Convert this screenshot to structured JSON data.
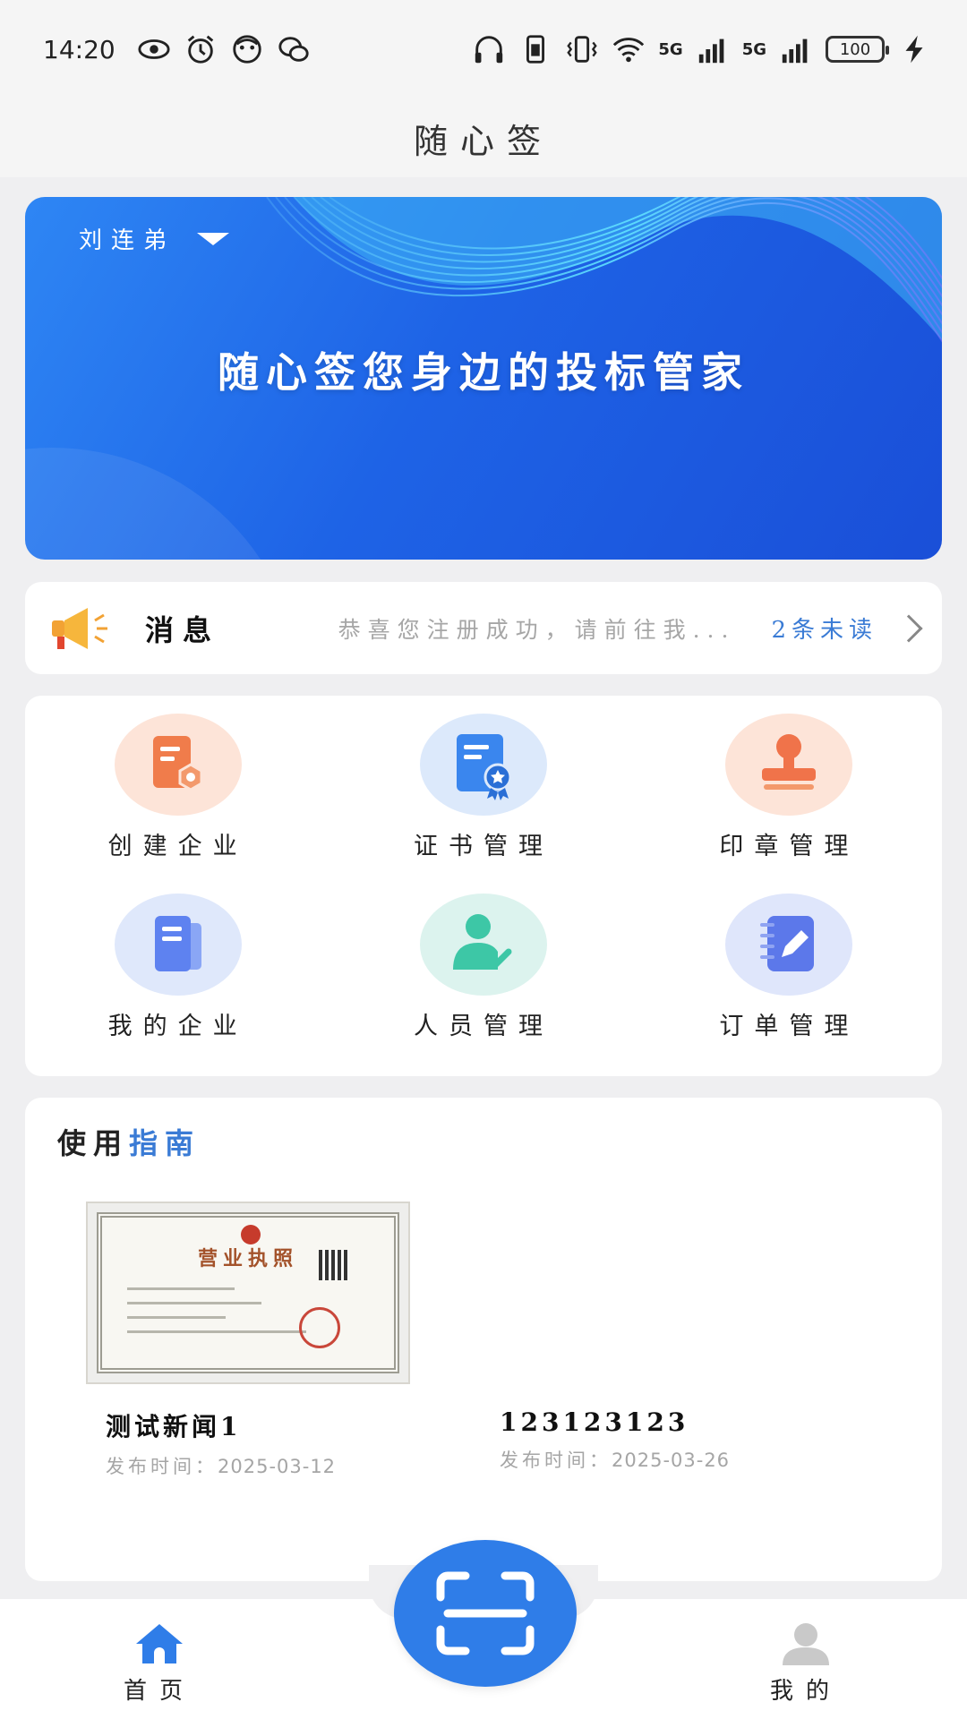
{
  "status_bar": {
    "time": "14:20",
    "signal1": "5G",
    "signal2": "5G",
    "battery": "100"
  },
  "header": {
    "title": "随心签"
  },
  "banner": {
    "user_name": "刘连弟",
    "slogan": "随心签您身边的投标管家"
  },
  "messages": {
    "title": "消息",
    "preview": "恭喜您注册成功，请前往我...",
    "unread": "2条未读"
  },
  "grid": {
    "items": [
      {
        "label": "创建企业",
        "icon": "company-create-icon",
        "bg": "#fde4d8",
        "color": "#f07c4b"
      },
      {
        "label": "证书管理",
        "icon": "certificate-icon",
        "bg": "#dce9fb",
        "color": "#3a86ee"
      },
      {
        "label": "印章管理",
        "icon": "stamp-icon",
        "bg": "#fde4d8",
        "color": "#f0734a"
      },
      {
        "label": "我的企业",
        "icon": "document-icon",
        "bg": "#dfe8fb",
        "color": "#5e82f0"
      },
      {
        "label": "人员管理",
        "icon": "person-check-icon",
        "bg": "#dcf3ee",
        "color": "#3dc7a6"
      },
      {
        "label": "订单管理",
        "icon": "notebook-edit-icon",
        "bg": "#dfe6fb",
        "color": "#5c78ea"
      }
    ]
  },
  "guide": {
    "title_prefix": "使用",
    "title_accent": "指南",
    "thumbnail_heading": "营业执照",
    "news": [
      {
        "title": "测试新闻1",
        "date_label": "发布时间：",
        "date": "2025-03-12"
      },
      {
        "title": "123123123",
        "date_label": "发布时间：",
        "date": "2025-03-26"
      }
    ]
  },
  "bottom_nav": {
    "home": "首页",
    "mine": "我的",
    "active_color": "#2f7de8",
    "inactive_color": "#c9c9c9"
  }
}
